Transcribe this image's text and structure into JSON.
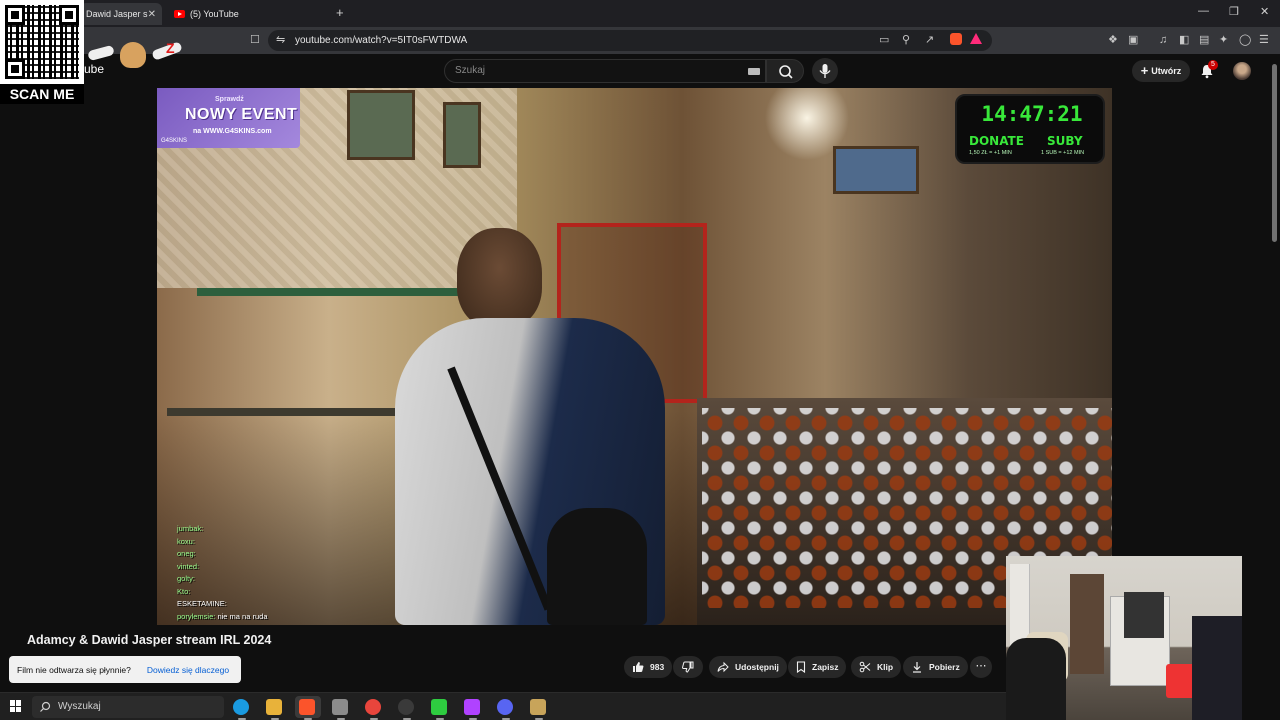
{
  "browser": {
    "tabs": [
      {
        "label": "Dawid Jasper s",
        "active": true
      },
      {
        "label": "(5) YouTube",
        "active": false
      }
    ],
    "close_glyph": "✕",
    "new_tab_glyph": "+",
    "window_controls": [
      "—",
      "❐",
      "✕"
    ],
    "url": "youtube.com/watch?v=5IT0sFWTDWA"
  },
  "youtube": {
    "logo_text": "ube",
    "search_placeholder": "Szukaj",
    "create_label": "Utwórz",
    "notification_count": "5"
  },
  "qr_overlay": {
    "label": "SCAN ME"
  },
  "video": {
    "event_overlay": {
      "small": "Sprawdź",
      "big": "NOWY EVENT",
      "sub": "na WWW.G4SKINS.com",
      "logo": "G4SKINS"
    },
    "timer_overlay": {
      "time": "14:47:21",
      "donate_label": "DONATE",
      "donate_sub": "1,50 ZŁ = +1 MIN",
      "subs_label": "SUBY",
      "subs_sub": "1 SUB = +12 MIN"
    },
    "chat": [
      {
        "user": "jumbak:",
        "msg": ""
      },
      {
        "user": "koxu:",
        "msg": ""
      },
      {
        "user": "oneg:",
        "msg": ""
      },
      {
        "user": "vinted:",
        "msg": ""
      },
      {
        "user": "golty:",
        "msg": ""
      },
      {
        "user": "Kto:",
        "msg": ""
      },
      {
        "user": "ESKETAMINE:",
        "msg": ""
      },
      {
        "user": "porylemsie:",
        "msg": "nie ma na ruda"
      }
    ]
  },
  "watch": {
    "title": "Adamcy & Dawid Jasper stream IRL 2024",
    "likes": "983",
    "share_label": "Udostępnij",
    "save_label": "Zapisz",
    "clip_label": "Klip",
    "download_label": "Pobierz",
    "more_glyph": "⋯"
  },
  "toast": {
    "text": "Film nie odtwarza się płynnie?",
    "link": "Dowiedz się dlaczego"
  },
  "taskbar": {
    "search_placeholder": "Wyszukaj",
    "apps": [
      {
        "icon": "edge-icon",
        "color": "#1a9ae0"
      },
      {
        "icon": "file-explorer-icon",
        "color": "#e8b23a"
      },
      {
        "icon": "brave-icon",
        "color": "#fb542b"
      },
      {
        "icon": "app-icon",
        "color": "#8b8b8b"
      },
      {
        "icon": "chrome-icon",
        "color": "#e8453c"
      },
      {
        "icon": "obs-icon",
        "color": "#3a3a3a"
      },
      {
        "icon": "play-icon",
        "color": "#2ecc40"
      },
      {
        "icon": "chat-app-icon",
        "color": "#b042ff"
      },
      {
        "icon": "discord-icon",
        "color": "#5865f2"
      },
      {
        "icon": "league-icon",
        "color": "#c8a45a"
      }
    ]
  },
  "colors": {
    "yt_red": "#ff0000",
    "timer_green": "#38e83a",
    "event_purple": "#7a5bc0",
    "link_blue": "#065fd4"
  }
}
